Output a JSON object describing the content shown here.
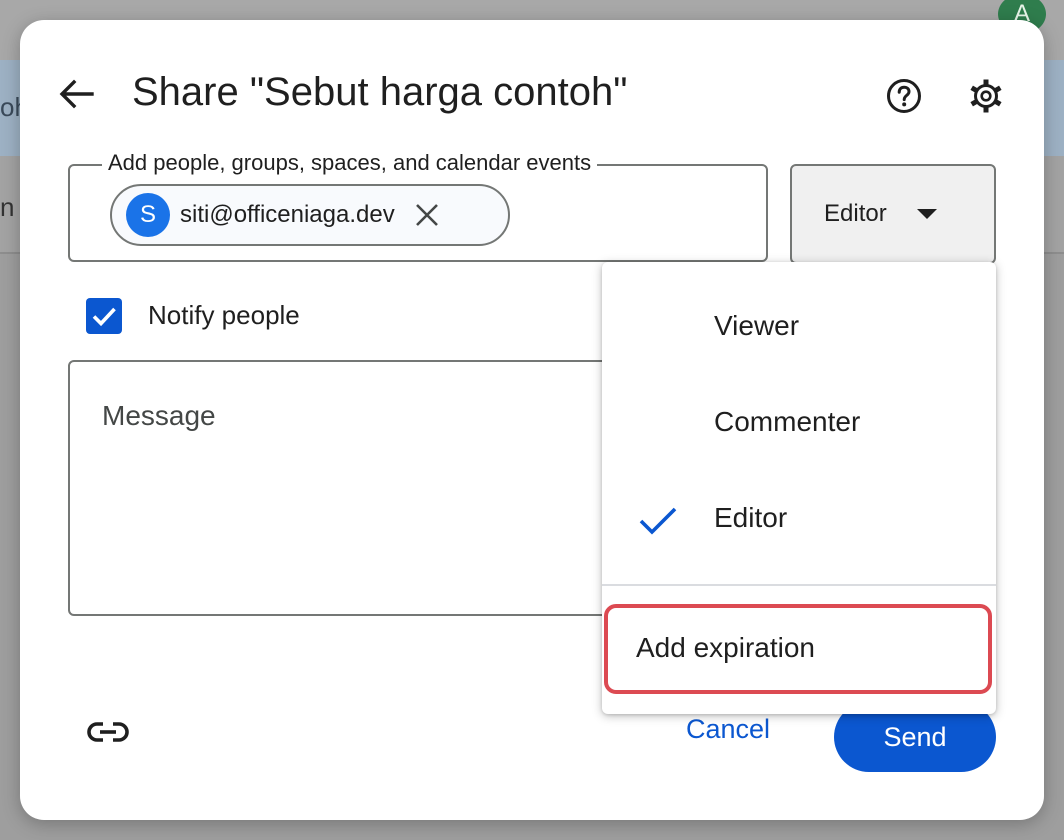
{
  "background": {
    "avatar_letter": "A",
    "left_text_1": "oh",
    "left_text_2": "n c"
  },
  "dialog": {
    "title": "Share \"Sebut harga contoh\"",
    "people_field": {
      "label": "Add people, groups, spaces, and calendar events",
      "chips": [
        {
          "avatar_letter": "S",
          "email": "siti@officeniaga.dev"
        }
      ]
    },
    "role": {
      "selected": "Editor"
    },
    "notify": {
      "label": "Notify people",
      "checked": true
    },
    "message": {
      "placeholder": "Message"
    },
    "footer": {
      "cancel_label": "Cancel",
      "send_label": "Send"
    }
  },
  "role_menu": {
    "items": [
      {
        "label": "Viewer",
        "selected": false
      },
      {
        "label": "Commenter",
        "selected": false
      },
      {
        "label": "Editor",
        "selected": true
      }
    ],
    "expiration_label": "Add expiration"
  },
  "colors": {
    "accent": "#0b57d0",
    "highlight_border": "#dc4a52",
    "text": "#1f1f1f",
    "outline": "#747775"
  },
  "icons": {
    "back": "arrow-left-icon",
    "help": "help-circle-icon",
    "settings": "gear-icon",
    "remove_chip": "close-icon",
    "dropdown": "caret-down-icon",
    "checkbox": "check-icon",
    "selected_role": "check-icon",
    "copy_link": "link-icon"
  }
}
